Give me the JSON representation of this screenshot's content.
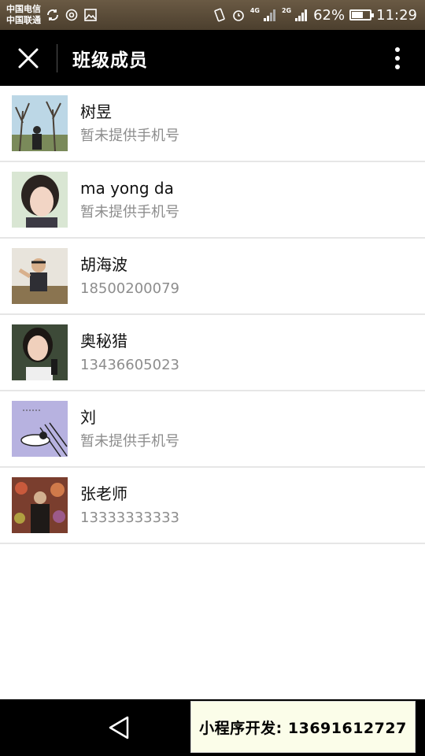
{
  "status_bar": {
    "carrier1": "中国电信",
    "carrier2": "中国联通",
    "net1": "4G",
    "net2": "2G",
    "battery": "62%",
    "battery_level": 0.62,
    "time": "11:29"
  },
  "header": {
    "title": "班级成员"
  },
  "members": [
    {
      "name": "树昱",
      "phone": "暂未提供手机号"
    },
    {
      "name": "ma yong da",
      "phone": "暂未提供手机号"
    },
    {
      "name": "胡海波",
      "phone": "18500200079"
    },
    {
      "name": "奥秘猎",
      "phone": "13436605023"
    },
    {
      "name": "刘",
      "phone": "暂未提供手机号"
    },
    {
      "name": "张老师",
      "phone": "13333333333"
    }
  ],
  "watermark": {
    "text": "小程序开发: 13691612727"
  }
}
